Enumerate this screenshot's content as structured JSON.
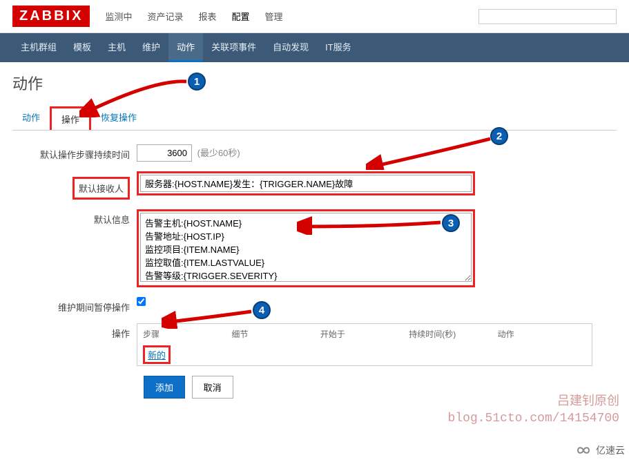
{
  "logo": "ZABBIX",
  "topnav": {
    "items": [
      "监测中",
      "资产记录",
      "报表",
      "配置",
      "管理"
    ],
    "activeIndex": 3
  },
  "subnav": {
    "items": [
      "主机群组",
      "模板",
      "主机",
      "维护",
      "动作",
      "关联项事件",
      "自动发现",
      "IT服务"
    ],
    "activeIndex": 4
  },
  "page_title": "动作",
  "tabs": {
    "items": [
      "动作",
      "操作",
      "恢复操作"
    ],
    "activeIndex": 1
  },
  "form": {
    "duration_label": "默认操作步骤持续时间",
    "duration_value": "3600",
    "duration_hint": "(最少60秒)",
    "recipient_label": "默认接收人",
    "recipient_value": "服务器:{HOST.NAME}发生：{TRIGGER.NAME}故障",
    "message_label": "默认信息",
    "message_value": "告警主机:{HOST.NAME}\n告警地址:{HOST.IP}\n监控项目:{ITEM.NAME}\n监控取值:{ITEM.LASTVALUE}\n告警等级:{TRIGGER.SEVERITY}\n当前状态:{TRIGGER.STATUS}",
    "pause_label": "维护期间暂停操作",
    "pause_checked": true,
    "ops_label": "操作",
    "ops_headers": [
      "步骤",
      "细节",
      "开始于",
      "持续时间(秒)",
      "动作"
    ],
    "ops_new": "新的",
    "add_btn": "添加",
    "cancel_btn": "取消"
  },
  "badges": {
    "b1": "1",
    "b2": "2",
    "b3": "3",
    "b4": "4"
  },
  "watermark": {
    "line1": "吕建钊原创",
    "line2": "blog.51cto.com/14154700"
  },
  "corner": "亿速云",
  "search_placeholder": ""
}
